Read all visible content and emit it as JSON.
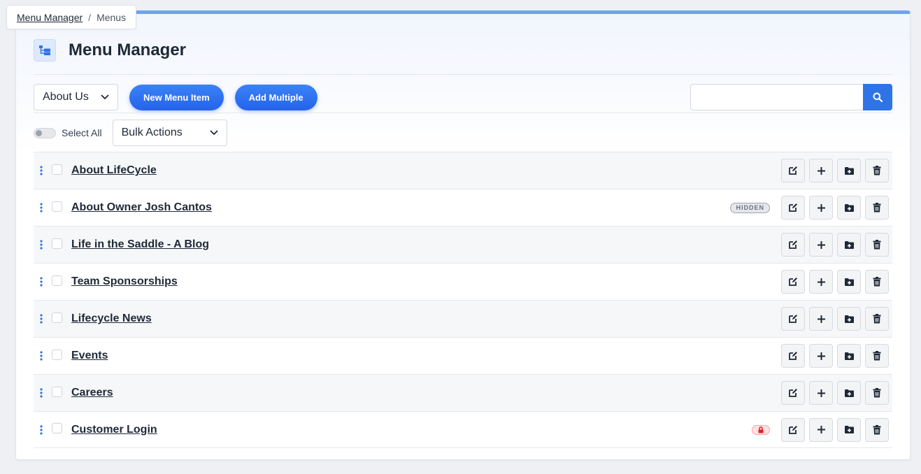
{
  "breadcrumb": {
    "root": "Menu Manager",
    "separator": "/",
    "current": "Menus"
  },
  "header": {
    "title": "Menu Manager",
    "icon": "sitemap-icon"
  },
  "toolbar": {
    "menu_select": "About Us",
    "new_item_label": "New Menu Item",
    "add_multiple_label": "Add Multiple",
    "search_value": "",
    "search_placeholder": ""
  },
  "bulk": {
    "select_all_label": "Select All",
    "bulk_actions": "Bulk Actions"
  },
  "colors": {
    "accent": "#2f74e6",
    "top_border": "#6ea3ee",
    "drag_handle": "#2f74e6"
  },
  "items": [
    {
      "label": "About LifeCycle",
      "badge": ""
    },
    {
      "label": "About Owner Josh Cantos",
      "badge": "HIDDEN"
    },
    {
      "label": "Life in the Saddle - A Blog",
      "badge": ""
    },
    {
      "label": "Team Sponsorships",
      "badge": ""
    },
    {
      "label": "Lifecycle News",
      "badge": ""
    },
    {
      "label": "Events",
      "badge": ""
    },
    {
      "label": "Careers",
      "badge": ""
    },
    {
      "label": "Customer Login",
      "badge": "lock-icon"
    }
  ]
}
